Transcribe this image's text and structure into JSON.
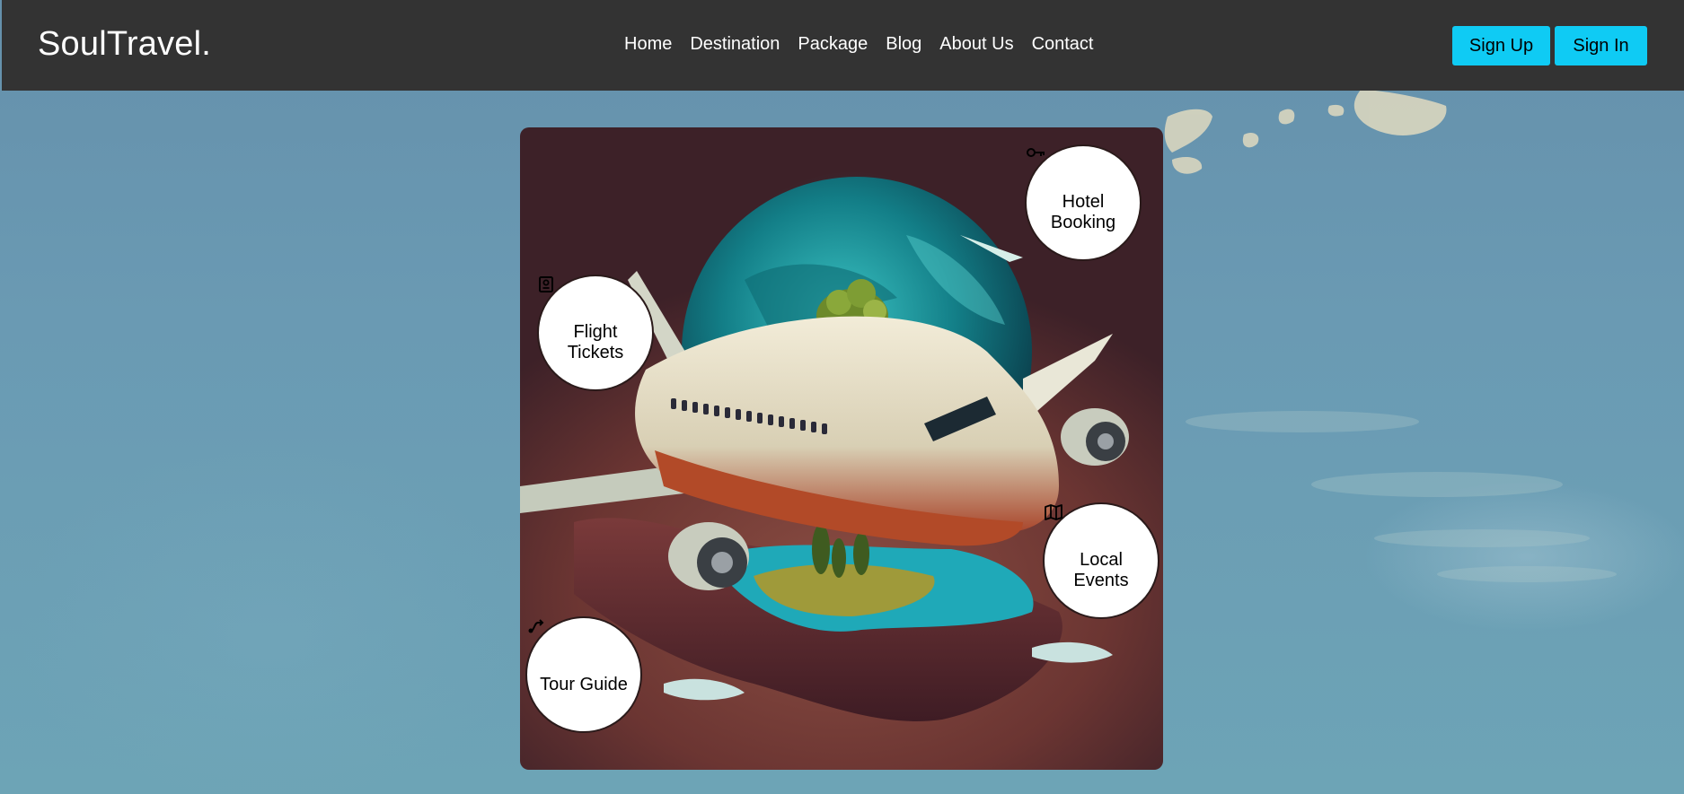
{
  "header": {
    "brand": "SoulTravel.",
    "nav": [
      {
        "label": "Home"
      },
      {
        "label": "Destination"
      },
      {
        "label": "Package"
      },
      {
        "label": "Blog"
      },
      {
        "label": "About Us"
      },
      {
        "label": "Contact"
      }
    ],
    "signup_label": "Sign Up",
    "signin_label": "Sign In"
  },
  "colors": {
    "header_bg": "#333333",
    "button_bg": "#0fcbf4",
    "page_bg": "#6794ad"
  },
  "hero": {
    "services": [
      {
        "label": "Hotel Booking",
        "icon": "key-icon"
      },
      {
        "label": "Flight Tickets",
        "icon": "passport-icon"
      },
      {
        "label": "Local Events",
        "icon": "map-icon"
      },
      {
        "label": "Tour Guide",
        "icon": "route-icon"
      }
    ]
  }
}
